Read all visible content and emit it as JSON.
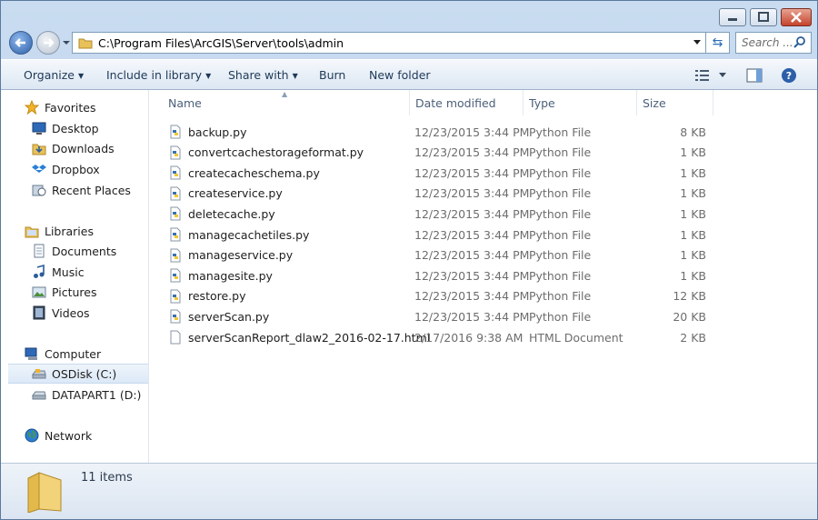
{
  "window": {
    "address_path": "C:\\Program Files\\ArcGIS\\Server\\tools\\admin",
    "search_placeholder": "Search ..."
  },
  "toolbar": {
    "organize": "Organize",
    "include_in_library": "Include in library",
    "share_with": "Share with",
    "burn": "Burn",
    "new_folder": "New folder"
  },
  "sidebar": {
    "favorites": {
      "label": "Favorites",
      "items": [
        "Desktop",
        "Downloads",
        "Dropbox",
        "Recent Places"
      ]
    },
    "libraries": {
      "label": "Libraries",
      "items": [
        "Documents",
        "Music",
        "Pictures",
        "Videos"
      ]
    },
    "computer": {
      "label": "Computer",
      "items": [
        "OSDisk (C:)",
        "DATAPART1 (D:)"
      ]
    },
    "network": {
      "label": "Network"
    }
  },
  "columns": {
    "name": "Name",
    "date": "Date modified",
    "type": "Type",
    "size": "Size"
  },
  "files": [
    {
      "name": "backup.py",
      "date": "12/23/2015 3:44 PM",
      "type": "Python File",
      "size": "8 KB"
    },
    {
      "name": "convertcachestorageformat.py",
      "date": "12/23/2015 3:44 PM",
      "type": "Python File",
      "size": "1 KB"
    },
    {
      "name": "createcacheschema.py",
      "date": "12/23/2015 3:44 PM",
      "type": "Python File",
      "size": "1 KB"
    },
    {
      "name": "createservice.py",
      "date": "12/23/2015 3:44 PM",
      "type": "Python File",
      "size": "1 KB"
    },
    {
      "name": "deletecache.py",
      "date": "12/23/2015 3:44 PM",
      "type": "Python File",
      "size": "1 KB"
    },
    {
      "name": "managecachetiles.py",
      "date": "12/23/2015 3:44 PM",
      "type": "Python File",
      "size": "1 KB"
    },
    {
      "name": "manageservice.py",
      "date": "12/23/2015 3:44 PM",
      "type": "Python File",
      "size": "1 KB"
    },
    {
      "name": "managesite.py",
      "date": "12/23/2015 3:44 PM",
      "type": "Python File",
      "size": "1 KB"
    },
    {
      "name": "restore.py",
      "date": "12/23/2015 3:44 PM",
      "type": "Python File",
      "size": "12 KB"
    },
    {
      "name": "serverScan.py",
      "date": "12/23/2015 3:44 PM",
      "type": "Python File",
      "size": "20 KB"
    },
    {
      "name": "serverScanReport_dlaw2_2016-02-17.html",
      "date": "2/17/2016 9:38 AM",
      "type": "HTML Document",
      "size": "2 KB"
    }
  ],
  "status": {
    "item_count": "11 items"
  },
  "colors": {
    "accent": "#2c5fa8",
    "close_button": "#c4432b",
    "toolbar_text": "#1e3957"
  }
}
